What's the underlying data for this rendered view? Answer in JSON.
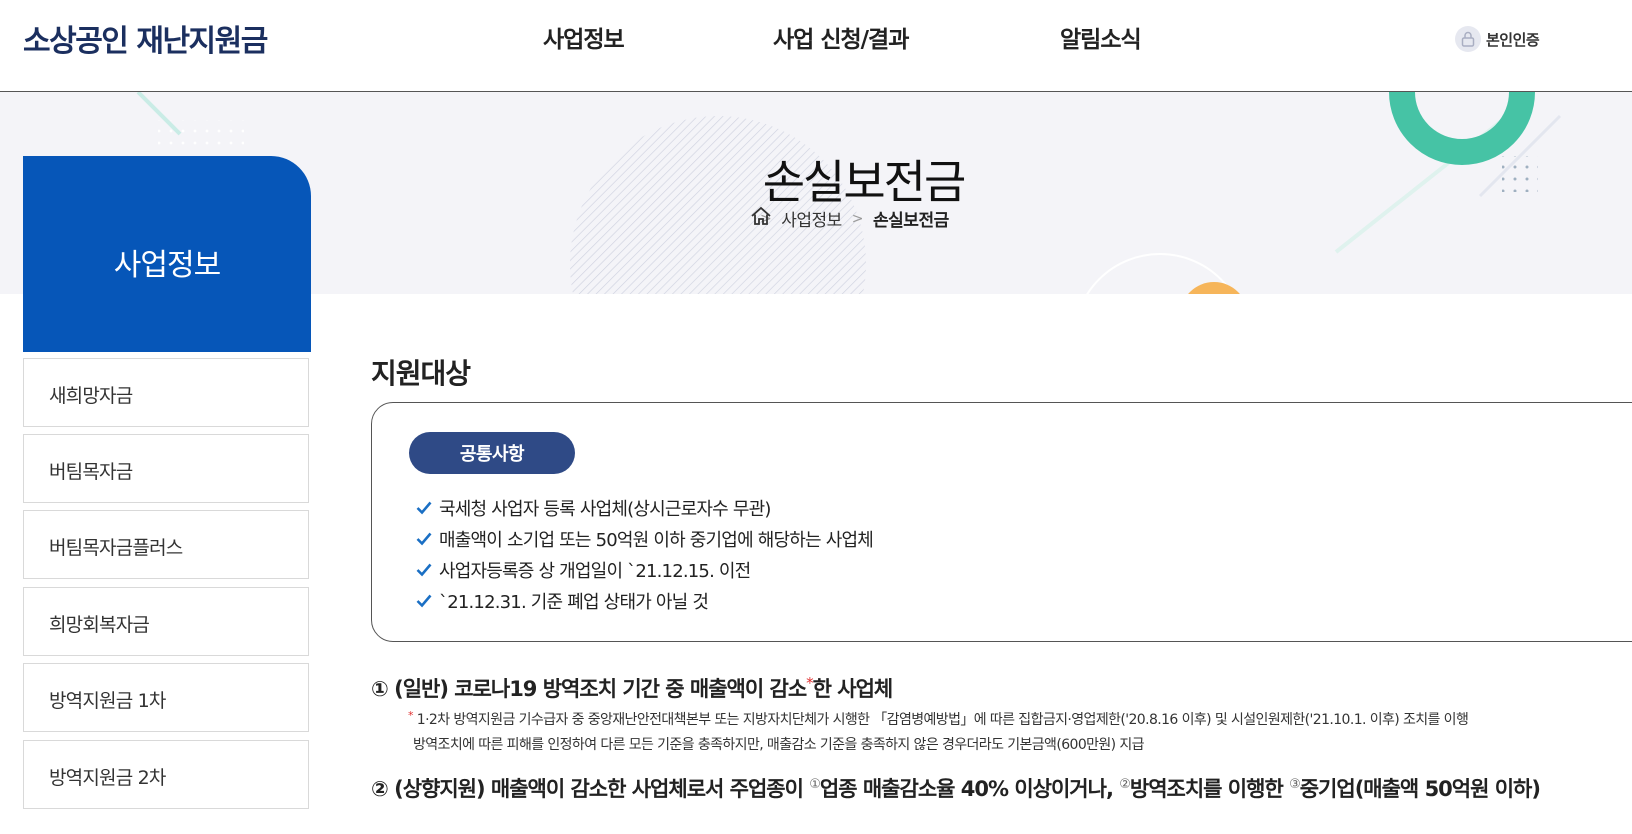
{
  "header": {
    "logo": "소상공인 재난지원금",
    "nav": [
      "사업정보",
      "사업 신청/결과",
      "알림소식"
    ],
    "auth_label": "본인인증"
  },
  "banner": {
    "title": "손실보전금",
    "breadcrumb": [
      "사업정보",
      "손실보전금"
    ]
  },
  "sidebar": {
    "heading": "사업정보",
    "items": [
      "새희망자금",
      "버팀목자금",
      "버팀목자금플러스",
      "희망회복자금",
      "방역지원금 1차",
      "방역지원금 2차"
    ]
  },
  "main": {
    "section_title": "지원대상",
    "common_label": "공통사항",
    "common_items": [
      "국세청 사업자 등록 사업체(상시근로자수 무관)",
      "매출액이 소기업 또는 50억원 이하 중기업에 해당하는 사업체",
      "사업자등록증 상 개업일이 `21.12.15. 이전",
      "`21.12.31. 기준 폐업 상태가 아닐 것"
    ],
    "criterion1": {
      "prefix": "① (일반) 코로나19 방역조치 기간 중 매출액이 감소",
      "star": "*",
      "suffix": "한 사업체"
    },
    "note1_star": "*",
    "note1_line1": "1·2차 방역지원금 기수급자 중 중앙재난안전대책본부 또는 지방자치단체가 시행한 「감염병예방법」에 따른 집합금지·영업제한('20.8.16 이후) 및 시설인원제한('21.10.1. 이후) 조치를 이행",
    "note1_line2": "방역조치에 따른 피해를 인정하여 다른 모든 기준을 충족하지만, 매출감소 기준을 충족하지 않은 경우더라도 기본금액(600만원) 지급",
    "criterion2": {
      "part1": "② (상향지원) 매출액이 감소한 사업체로서 주업종이 ",
      "sup1": "①",
      "part2": "업종 매출감소율 40% 이상이거나, ",
      "sup2": "②",
      "part3": "방역조치를 이행한 ",
      "sup3": "③",
      "part4": "중기업(매출액 50억원 이하)"
    }
  },
  "colors": {
    "primary": "#0656b8",
    "pill": "#2f4a86",
    "logo": "#1b2f5f",
    "check": "#1a6fc4",
    "accent_green": "#46c3a5",
    "accent_orange": "#f6b55a"
  }
}
